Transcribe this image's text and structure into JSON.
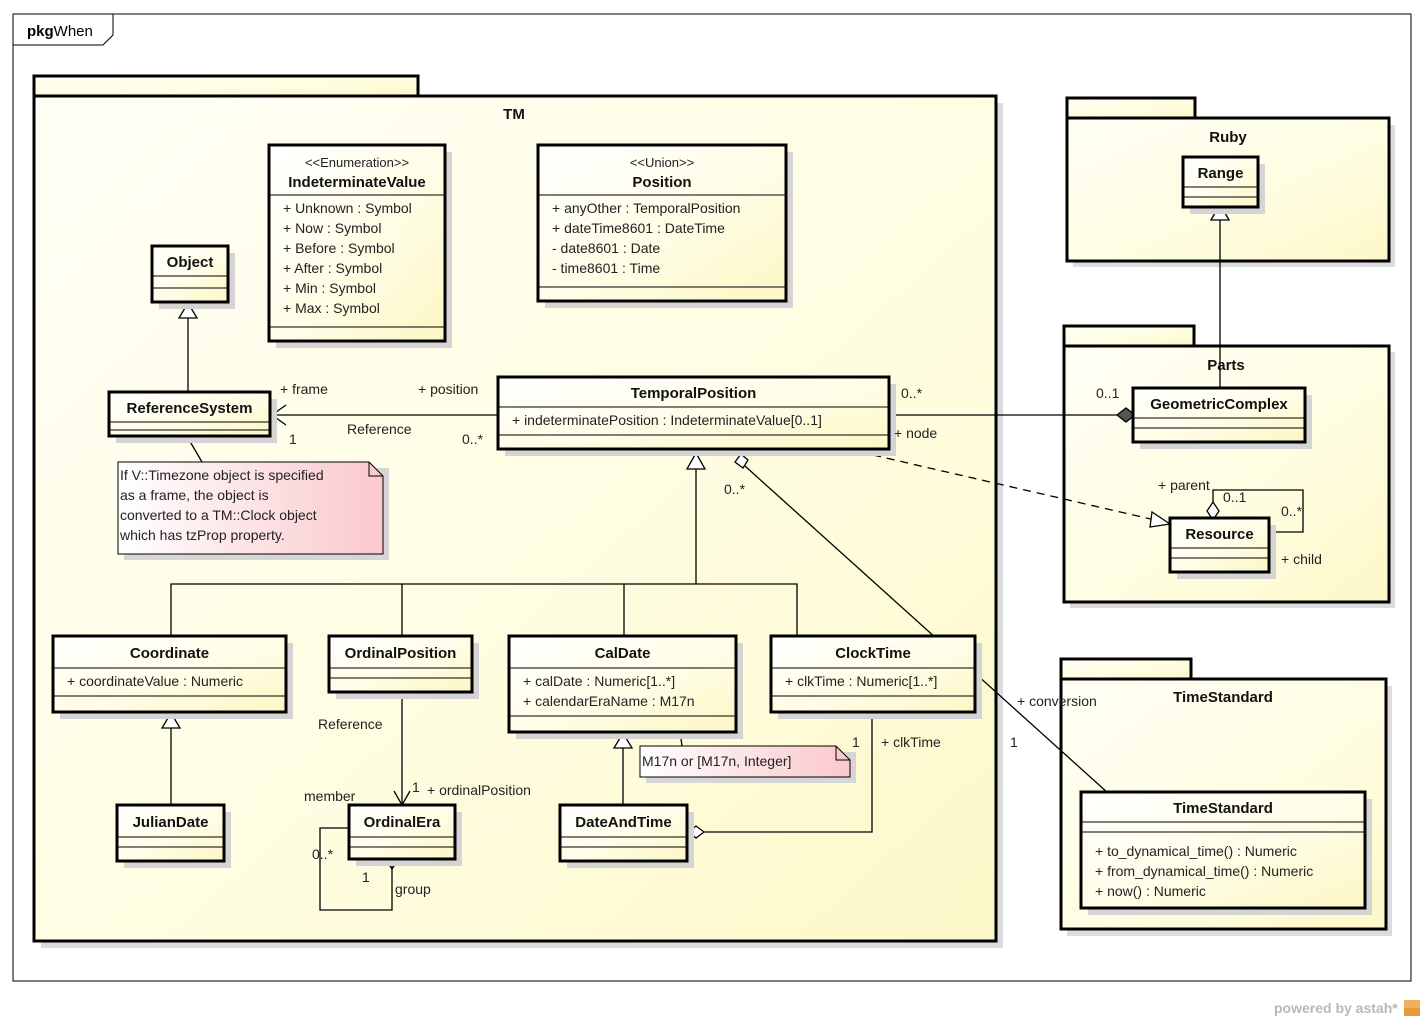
{
  "frame": {
    "keyword": "pkg",
    "name": "When"
  },
  "packages": {
    "tm": {
      "name": "TM"
    },
    "ruby": {
      "name": "Ruby"
    },
    "parts": {
      "name": "Parts"
    },
    "time_standard": {
      "name": "TimeStandard"
    }
  },
  "classes": {
    "indeterminate_value": {
      "stereotype": "<<Enumeration>>",
      "name": "IndeterminateValue",
      "attributes": [
        "+ Unknown : Symbol",
        "+ Now : Symbol",
        "+ Before : Symbol",
        "+ After : Symbol",
        "+ Min : Symbol",
        "+ Max : Symbol"
      ]
    },
    "position": {
      "stereotype": "<<Union>>",
      "name": "Position",
      "attributes": [
        "+ anyOther : TemporalPosition",
        "+ dateTime8601 : DateTime",
        "- date8601 : Date",
        "- time8601 : Time"
      ]
    },
    "object": {
      "name": "Object"
    },
    "reference_system": {
      "name": "ReferenceSystem"
    },
    "temporal_position": {
      "name": "TemporalPosition",
      "attributes": [
        "+ indeterminatePosition : IndeterminateValue[0..1]"
      ]
    },
    "coordinate": {
      "name": "Coordinate",
      "attributes": [
        "+ coordinateValue : Numeric"
      ]
    },
    "ordinal_position": {
      "name": "OrdinalPosition"
    },
    "cal_date": {
      "name": "CalDate",
      "attributes": [
        "+ calDate : Numeric[1..*]",
        "+ calendarEraName : M17n"
      ]
    },
    "clock_time": {
      "name": "ClockTime",
      "attributes": [
        "+ clkTime : Numeric[1..*]"
      ]
    },
    "julian_date": {
      "name": "JulianDate"
    },
    "ordinal_era": {
      "name": "OrdinalEra"
    },
    "date_and_time": {
      "name": "DateAndTime"
    },
    "range": {
      "name": "Range"
    },
    "geometric_complex": {
      "name": "GeometricComplex"
    },
    "resource": {
      "name": "Resource"
    },
    "time_standard": {
      "name": "TimeStandard",
      "operations": [
        "+ to_dynamical_time() : Numeric",
        "+ from_dynamical_time() : Numeric",
        "+ now() : Numeric"
      ]
    }
  },
  "notes": {
    "timezone": {
      "lines": [
        "If V::Timezone object is specified",
        "as a frame, the object is",
        "converted to a TM::Clock object",
        "which has tzProp property."
      ]
    },
    "m17n": {
      "lines": [
        "M17n or [M17n, Integer]"
      ]
    }
  },
  "edge_labels": {
    "frame_role": "+ frame",
    "position_role": "+ position",
    "reference_name": "Reference",
    "frame_mult": "1",
    "position_mult": "0..*",
    "node_mult": "0..*",
    "node_role": "+ node",
    "geo_mult": "0..1",
    "tp_agg_mult": "0..*",
    "parent_role": "+ parent",
    "parent_mult": "0..1",
    "child_mult": "0..*",
    "child_role": "+ child",
    "ordinal_reference": "Reference",
    "ordinal_mult": "1",
    "ordinal_role": "+ ordinalPosition",
    "member_role": "member",
    "member_mult": "0..*",
    "group_mult": "1",
    "group_role": "group",
    "clk_mult": "1",
    "clk_role": "+ clkTime",
    "conversion_role": "+ conversion",
    "conversion_mult": "1"
  },
  "footer": {
    "powered_by": "powered by astah*"
  },
  "colors": {
    "fill_light": "#fffff2",
    "fill_yellow": "#fdfbd0",
    "note_pink": "#fbd7d9",
    "shadow": "#d6d6d6",
    "line": "#000000"
  }
}
